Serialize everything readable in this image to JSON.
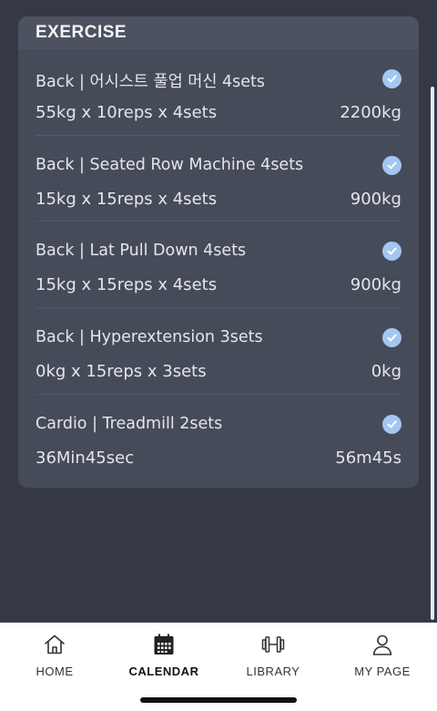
{
  "section": {
    "title": "EXERCISE"
  },
  "exercises": [
    {
      "title": "Back | 어시스트 풀업 머신 4sets",
      "detail": "55kg x 10reps x 4sets",
      "total": "2200kg"
    },
    {
      "title": "Back | Seated Row Machine 4sets",
      "detail": "15kg x 15reps x 4sets",
      "total": "900kg"
    },
    {
      "title": "Back | Lat Pull Down 4sets",
      "detail": "15kg x 15reps x 4sets",
      "total": "900kg"
    },
    {
      "title": "Back | Hyperextension 3sets",
      "detail": "0kg x 15reps x 3sets",
      "total": "0kg"
    },
    {
      "title": "Cardio | Treadmill 2sets",
      "detail": "36Min45sec",
      "total": "56m45s"
    }
  ],
  "tabs": [
    {
      "label": "HOME",
      "icon": "home-icon"
    },
    {
      "label": "CALENDAR",
      "icon": "calendar-icon",
      "active": true
    },
    {
      "label": "LIBRARY",
      "icon": "dumbbell-icon"
    },
    {
      "label": "MY PAGE",
      "icon": "user-icon"
    }
  ],
  "colors": {
    "background": "#353945",
    "card": "#464b59",
    "check": "#a3c6f2",
    "tabbar": "#ffffff"
  }
}
